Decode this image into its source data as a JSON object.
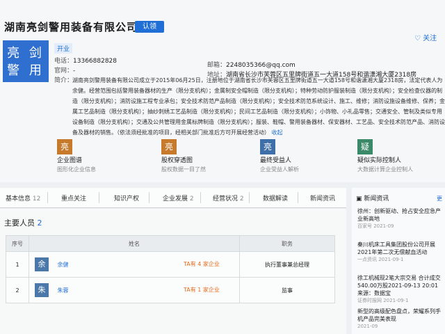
{
  "company": {
    "name": "湖南亮剑警用装备有限公司",
    "auth_label": "认领",
    "follow_label": "关注",
    "logo_line1": "亮 剑",
    "logo_line2": "警 用",
    "status": "开业",
    "phone_label": "电话：",
    "phone": "13366882828",
    "site_label": "官网：",
    "site": "-",
    "email_label": "邮箱：",
    "email": "2248035366@qq.com",
    "address_label": "地址：",
    "address": "湖南省长沙市芙蓉区五里牌街道五一大道158号和谐潇湘大厦2318房",
    "intro_label": "简介：",
    "intro": "湖南亮剑警用装备有限公司成立于2015年06月25日，注册地位于湖南省长沙市芙蓉区五里牌街道五一大道158号和谐潇湘大厦2318房，法定代表人为余健。经营范围包括警用装备器材的生产（限分支机构）；金属制安全帽制造（限分支机构）；特种劳动防护服装制造（限分支机构）；安全检查仪器的制造（限分支机构）；消防设施工程专业承包；安全技术防范产品制造（限分支机构）；安全技术防范系统设计、施工、维修；消防设施设备维修、保养；金属工艺品制造（限分支机构）；抽纱刺绣工艺品制造（限分支机构）；民间工艺品制造（限分支机构）；小饰物、小礼品零售；交通安全、管制及类似专用设备制造（限分支机构）；交通及公共管理用金属标牌制造（限分支机构）；服装、鞋帽、警用装备器材、保安器材、工艺品、安全技术防范产品、消防设备及器材的销售。（依法须经批准的项目，经相关部门批准后方可开展经营活动）",
    "intro_more": "收起"
  },
  "cards": [
    {
      "icon": "亮",
      "title": "企业图谱",
      "sub": "图形化企业信息",
      "color": "#c77a2b"
    },
    {
      "icon": "亮",
      "title": "股权穿透图",
      "sub": "股权数据一目了然",
      "color": "#c77a2b"
    },
    {
      "icon": "亮",
      "title": "最终受益人",
      "sub": "企业受益人解析",
      "color": "#3f6fa8"
    },
    {
      "icon": "疑",
      "title": "疑似实际控制人",
      "sub": "大数据计算企业控制人",
      "color": "#3a8a6a"
    }
  ],
  "tabs": [
    {
      "label": "基本信息",
      "count": "12"
    },
    {
      "label": "重点关注",
      "count": ""
    },
    {
      "label": "知识产权",
      "count": ""
    },
    {
      "label": "企业发展",
      "count": "2"
    },
    {
      "label": "经营状况",
      "count": "2"
    },
    {
      "label": "数据解读",
      "count": ""
    },
    {
      "label": "新闻资讯",
      "count": ""
    }
  ],
  "people": {
    "title": "主要人员",
    "count": "2",
    "headers": [
      "序号",
      "姓名",
      "职务"
    ],
    "rows": [
      {
        "index": "1",
        "avatar": "余",
        "name": "余健",
        "ta": "TA有 4 家企业",
        "role": "执行董事兼总经理",
        "color": "#4a78a8"
      },
      {
        "index": "2",
        "avatar": "朱",
        "name": "朱蓉",
        "ta": "TA有 1 家企业",
        "role": "监事",
        "color": "#4a78a8"
      }
    ]
  },
  "side": {
    "title": "新闻资讯",
    "more": "更",
    "items": [
      {
        "text": "徐州：创新驱动、抢占安全应急产业新高地",
        "meta": "百家号 2021-09"
      },
      {
        "text": "秦川机床工具集团股份公司开展2021年第二次无偿献血活动",
        "meta": "一点资讯 2021-09-1"
      },
      {
        "text": "徐工机械现2笔大宗交易 合计成交540.00万股2021-09-13 20:01 来源：数据宝",
        "meta": "证券时报网 2021-09-1"
      },
      {
        "text": "新型的高级配色盘点，荣耀系列手机产品完美表现",
        "meta": "2021-09"
      }
    ]
  }
}
